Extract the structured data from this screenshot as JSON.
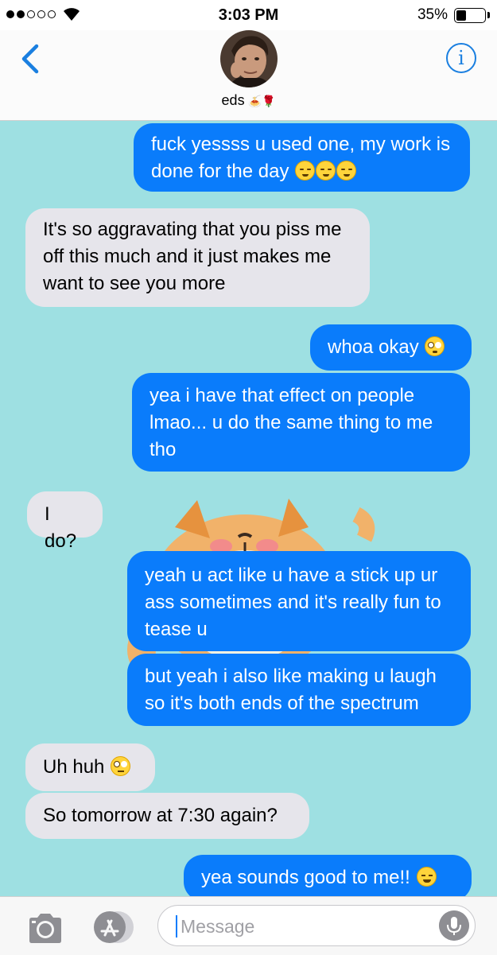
{
  "status_bar": {
    "time": "3:03 PM",
    "battery_percent": "35%",
    "battery_level": 0.35,
    "signal_bars_filled": 2,
    "signal_bars_total": 5
  },
  "header": {
    "back_icon": "chevron-left-icon",
    "contact_name": "eds",
    "contact_emoji": "🍝🌹",
    "info_icon": "i"
  },
  "messages": [
    {
      "side": "out",
      "text": "fuck yessss u used one, my work is done for the day",
      "emoji": [
        "relieved",
        "relieved",
        "relieved"
      ]
    },
    {
      "side": "in",
      "text": "It's so aggravating that you piss me off this much and it just makes me want to see you more"
    },
    {
      "side": "out",
      "text": "whoa okay",
      "emoji": [
        "flushed"
      ]
    },
    {
      "side": "out",
      "text": "yea i have that effect on people lmao... u do the same thing to me tho"
    },
    {
      "side": "in",
      "text": "I do?"
    },
    {
      "side": "out",
      "text": "yeah u act like u have a stick up ur ass sometimes and it's really fun to tease u"
    },
    {
      "side": "out",
      "text": "but yeah i also like making u laugh so it's both ends of the spectrum"
    },
    {
      "side": "in",
      "text": "Uh huh",
      "emoji": [
        "rolling"
      ]
    },
    {
      "side": "in",
      "text": "So tomorrow at 7:30 again?"
    },
    {
      "side": "out",
      "text": "yea sounds good to me!!",
      "emoji": [
        "blush"
      ]
    }
  ],
  "sticker": {
    "icon": "shiba-dog-sticker"
  },
  "input_bar": {
    "placeholder": "Message",
    "camera_icon": "camera-icon",
    "apps_icon": "app-store-icon",
    "mic_icon": "microphone-icon"
  },
  "colors": {
    "chat_background": "#9ee0e2",
    "outgoing_bubble": "#0a7cfb",
    "incoming_bubble": "#e6e5eb",
    "accent": "#1a7fe0"
  }
}
